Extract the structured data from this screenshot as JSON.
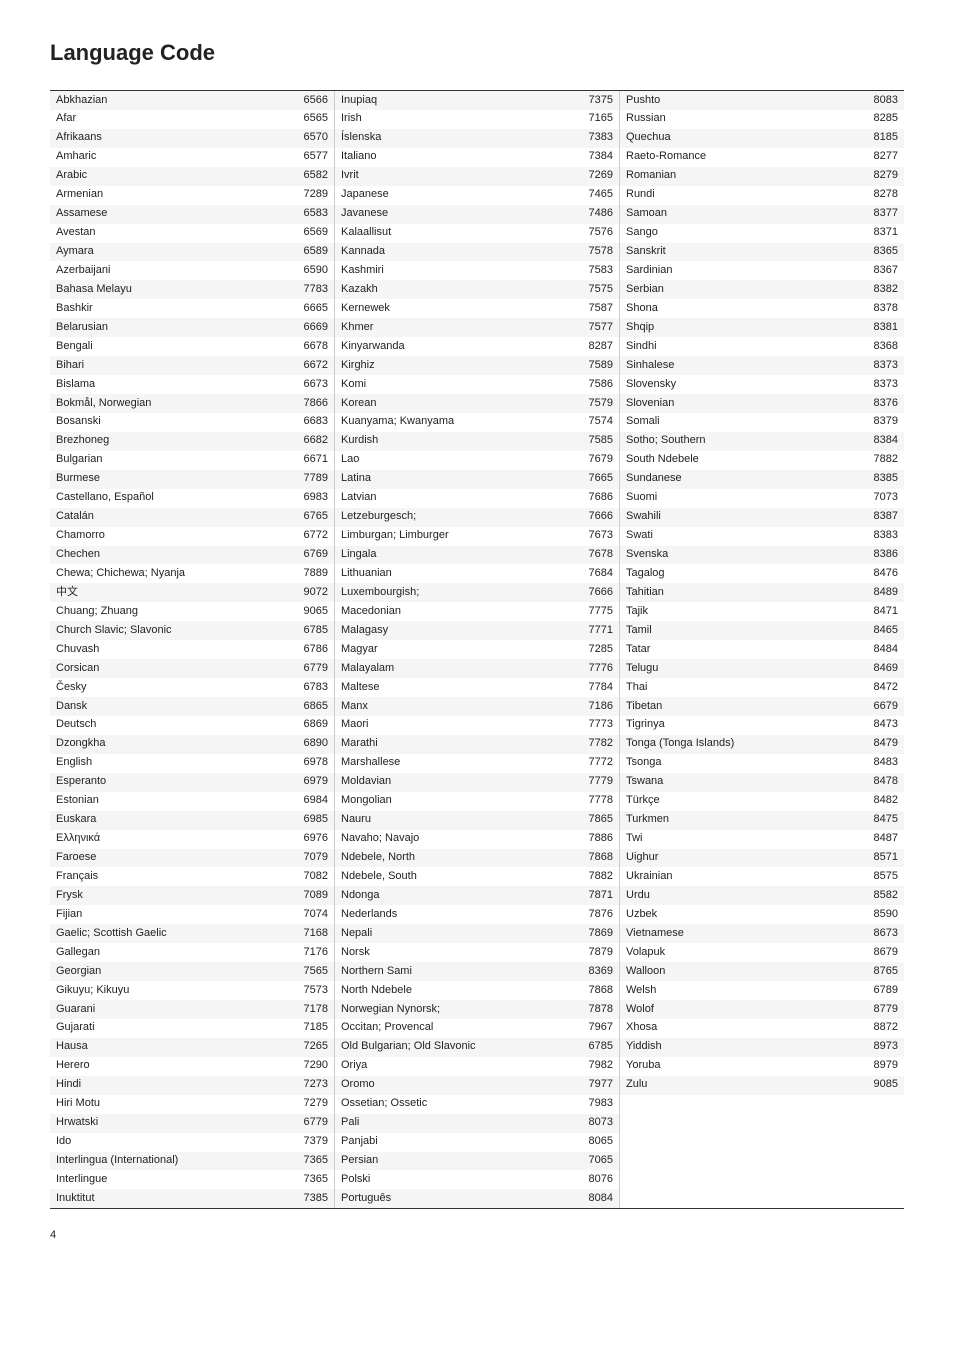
{
  "title": "Language Code",
  "page_number": "4",
  "columns": [
    [
      {
        "name": "Abkhazian",
        "code": "6566"
      },
      {
        "name": "Afar",
        "code": "6565"
      },
      {
        "name": "Afrikaans",
        "code": "6570"
      },
      {
        "name": "Amharic",
        "code": "6577"
      },
      {
        "name": "Arabic",
        "code": "6582"
      },
      {
        "name": "Armenian",
        "code": "7289"
      },
      {
        "name": "Assamese",
        "code": "6583"
      },
      {
        "name": "Avestan",
        "code": "6569"
      },
      {
        "name": "Aymara",
        "code": "6589"
      },
      {
        "name": "Azerbaijani",
        "code": "6590"
      },
      {
        "name": "Bahasa Melayu",
        "code": "7783"
      },
      {
        "name": "Bashkir",
        "code": "6665"
      },
      {
        "name": "Belarusian",
        "code": "6669"
      },
      {
        "name": "Bengali",
        "code": "6678"
      },
      {
        "name": "Bihari",
        "code": "6672"
      },
      {
        "name": "Bislama",
        "code": "6673"
      },
      {
        "name": "Bokmål, Norwegian",
        "code": "7866"
      },
      {
        "name": "Bosanski",
        "code": "6683"
      },
      {
        "name": "Brezhoneg",
        "code": "6682"
      },
      {
        "name": "Bulgarian",
        "code": "6671"
      },
      {
        "name": "Burmese",
        "code": "7789"
      },
      {
        "name": "Castellano, Español",
        "code": "6983"
      },
      {
        "name": "Catalán",
        "code": "6765"
      },
      {
        "name": "Chamorro",
        "code": "6772"
      },
      {
        "name": "Chechen",
        "code": "6769"
      },
      {
        "name": "Chewa; Chichewa; Nyanja",
        "code": "7889"
      },
      {
        "name": "中文",
        "code": "9072"
      },
      {
        "name": "Chuang; Zhuang",
        "code": "9065"
      },
      {
        "name": "Church Slavic; Slavonic",
        "code": "6785"
      },
      {
        "name": "Chuvash",
        "code": "6786"
      },
      {
        "name": "Corsican",
        "code": "6779"
      },
      {
        "name": "Česky",
        "code": "6783"
      },
      {
        "name": "Dansk",
        "code": "6865"
      },
      {
        "name": "Deutsch",
        "code": "6869"
      },
      {
        "name": "Dzongkha",
        "code": "6890"
      },
      {
        "name": "English",
        "code": "6978"
      },
      {
        "name": "Esperanto",
        "code": "6979"
      },
      {
        "name": "Estonian",
        "code": "6984"
      },
      {
        "name": "Euskara",
        "code": "6985"
      },
      {
        "name": "Ελληνικά",
        "code": "6976"
      },
      {
        "name": "Faroese",
        "code": "7079"
      },
      {
        "name": "Français",
        "code": "7082"
      },
      {
        "name": "Frysk",
        "code": "7089"
      },
      {
        "name": "Fijian",
        "code": "7074"
      },
      {
        "name": "Gaelic; Scottish Gaelic",
        "code": "7168"
      },
      {
        "name": "Gallegan",
        "code": "7176"
      },
      {
        "name": "Georgian",
        "code": "7565"
      },
      {
        "name": "Gikuyu; Kikuyu",
        "code": "7573"
      },
      {
        "name": "Guarani",
        "code": "7178"
      },
      {
        "name": "Gujarati",
        "code": "7185"
      },
      {
        "name": "Hausa",
        "code": "7265"
      },
      {
        "name": "Herero",
        "code": "7290"
      },
      {
        "name": "Hindi",
        "code": "7273"
      },
      {
        "name": "Hiri Motu",
        "code": "7279"
      },
      {
        "name": "Hrwatski",
        "code": "6779"
      },
      {
        "name": "Ido",
        "code": "7379"
      },
      {
        "name": "Interlingua (International)",
        "code": "7365"
      },
      {
        "name": "Interlingue",
        "code": "7365"
      },
      {
        "name": "Inuktitut",
        "code": "7385"
      }
    ],
    [
      {
        "name": "Inupiaq",
        "code": "7375"
      },
      {
        "name": "Irish",
        "code": "7165"
      },
      {
        "name": "Íslenska",
        "code": "7383"
      },
      {
        "name": "Italiano",
        "code": "7384"
      },
      {
        "name": "Ivrit",
        "code": "7269"
      },
      {
        "name": "Japanese",
        "code": "7465"
      },
      {
        "name": "Javanese",
        "code": "7486"
      },
      {
        "name": "Kalaallisut",
        "code": "7576"
      },
      {
        "name": "Kannada",
        "code": "7578"
      },
      {
        "name": "Kashmiri",
        "code": "7583"
      },
      {
        "name": "Kazakh",
        "code": "7575"
      },
      {
        "name": "Kernewek",
        "code": "7587"
      },
      {
        "name": "Khmer",
        "code": "7577"
      },
      {
        "name": "Kinyarwanda",
        "code": "8287"
      },
      {
        "name": "Kirghiz",
        "code": "7589"
      },
      {
        "name": "Komi",
        "code": "7586"
      },
      {
        "name": "Korean",
        "code": "7579"
      },
      {
        "name": "Kuanyama; Kwanyama",
        "code": "7574"
      },
      {
        "name": "Kurdish",
        "code": "7585"
      },
      {
        "name": "Lao",
        "code": "7679"
      },
      {
        "name": "Latina",
        "code": "7665"
      },
      {
        "name": "Latvian",
        "code": "7686"
      },
      {
        "name": "Letzeburgesch;",
        "code": "7666"
      },
      {
        "name": "Limburgan; Limburger",
        "code": "7673"
      },
      {
        "name": "Lingala",
        "code": "7678"
      },
      {
        "name": "Lithuanian",
        "code": "7684"
      },
      {
        "name": "Luxembourgish;",
        "code": "7666"
      },
      {
        "name": "Macedonian",
        "code": "7775"
      },
      {
        "name": "Malagasy",
        "code": "7771"
      },
      {
        "name": "Magyar",
        "code": "7285"
      },
      {
        "name": "Malayalam",
        "code": "7776"
      },
      {
        "name": "Maltese",
        "code": "7784"
      },
      {
        "name": "Manx",
        "code": "7186"
      },
      {
        "name": "Maori",
        "code": "7773"
      },
      {
        "name": "Marathi",
        "code": "7782"
      },
      {
        "name": "Marshallese",
        "code": "7772"
      },
      {
        "name": "Moldavian",
        "code": "7779"
      },
      {
        "name": "Mongolian",
        "code": "7778"
      },
      {
        "name": "Nauru",
        "code": "7865"
      },
      {
        "name": "Navaho; Navajo",
        "code": "7886"
      },
      {
        "name": "Ndebele, North",
        "code": "7868"
      },
      {
        "name": "Ndebele, South",
        "code": "7882"
      },
      {
        "name": "Ndonga",
        "code": "7871"
      },
      {
        "name": "Nederlands",
        "code": "7876"
      },
      {
        "name": "Nepali",
        "code": "7869"
      },
      {
        "name": "Norsk",
        "code": "7879"
      },
      {
        "name": "Northern Sami",
        "code": "8369"
      },
      {
        "name": "North Ndebele",
        "code": "7868"
      },
      {
        "name": "Norwegian Nynorsk;",
        "code": "7878"
      },
      {
        "name": "Occitan; Provencal",
        "code": "7967"
      },
      {
        "name": "Old Bulgarian; Old Slavonic",
        "code": "6785"
      },
      {
        "name": "Oriya",
        "code": "7982"
      },
      {
        "name": "Oromo",
        "code": "7977"
      },
      {
        "name": "Ossetian; Ossetic",
        "code": "7983"
      },
      {
        "name": "Pali",
        "code": "8073"
      },
      {
        "name": "Panjabi",
        "code": "8065"
      },
      {
        "name": "Persian",
        "code": "7065"
      },
      {
        "name": "Polski",
        "code": "8076"
      },
      {
        "name": "Português",
        "code": "8084"
      }
    ],
    [
      {
        "name": "Pushto",
        "code": "8083"
      },
      {
        "name": "Russian",
        "code": "8285"
      },
      {
        "name": "Quechua",
        "code": "8185"
      },
      {
        "name": "Raeto-Romance",
        "code": "8277"
      },
      {
        "name": "Romanian",
        "code": "8279"
      },
      {
        "name": "Rundi",
        "code": "8278"
      },
      {
        "name": "Samoan",
        "code": "8377"
      },
      {
        "name": "Sango",
        "code": "8371"
      },
      {
        "name": "Sanskrit",
        "code": "8365"
      },
      {
        "name": "Sardinian",
        "code": "8367"
      },
      {
        "name": "Serbian",
        "code": "8382"
      },
      {
        "name": "Shona",
        "code": "8378"
      },
      {
        "name": "Shqip",
        "code": "8381"
      },
      {
        "name": "Sindhi",
        "code": "8368"
      },
      {
        "name": "Sinhalese",
        "code": "8373"
      },
      {
        "name": "Slovensky",
        "code": "8373"
      },
      {
        "name": "Slovenian",
        "code": "8376"
      },
      {
        "name": "Somali",
        "code": "8379"
      },
      {
        "name": "Sotho; Southern",
        "code": "8384"
      },
      {
        "name": "South Ndebele",
        "code": "7882"
      },
      {
        "name": "Sundanese",
        "code": "8385"
      },
      {
        "name": "Suomi",
        "code": "7073"
      },
      {
        "name": "Swahili",
        "code": "8387"
      },
      {
        "name": "Swati",
        "code": "8383"
      },
      {
        "name": "Svenska",
        "code": "8386"
      },
      {
        "name": "Tagalog",
        "code": "8476"
      },
      {
        "name": "Tahitian",
        "code": "8489"
      },
      {
        "name": "Tajik",
        "code": "8471"
      },
      {
        "name": "Tamil",
        "code": "8465"
      },
      {
        "name": "Tatar",
        "code": "8484"
      },
      {
        "name": "Telugu",
        "code": "8469"
      },
      {
        "name": "Thai",
        "code": "8472"
      },
      {
        "name": "Tibetan",
        "code": "6679"
      },
      {
        "name": "Tigrinya",
        "code": "8473"
      },
      {
        "name": "Tonga (Tonga Islands)",
        "code": "8479"
      },
      {
        "name": "Tsonga",
        "code": "8483"
      },
      {
        "name": "Tswana",
        "code": "8478"
      },
      {
        "name": "Türkçe",
        "code": "8482"
      },
      {
        "name": "Turkmen",
        "code": "8475"
      },
      {
        "name": "Twi",
        "code": "8487"
      },
      {
        "name": "Uighur",
        "code": "8571"
      },
      {
        "name": "Ukrainian",
        "code": "8575"
      },
      {
        "name": "Urdu",
        "code": "8582"
      },
      {
        "name": "Uzbek",
        "code": "8590"
      },
      {
        "name": "Vietnamese",
        "code": "8673"
      },
      {
        "name": "Volapuk",
        "code": "8679"
      },
      {
        "name": "Walloon",
        "code": "8765"
      },
      {
        "name": "Welsh",
        "code": "6789"
      },
      {
        "name": "Wolof",
        "code": "8779"
      },
      {
        "name": "Xhosa",
        "code": "8872"
      },
      {
        "name": "Yiddish",
        "code": "8973"
      },
      {
        "name": "Yoruba",
        "code": "8979"
      },
      {
        "name": "Zulu",
        "code": "9085"
      }
    ]
  ]
}
